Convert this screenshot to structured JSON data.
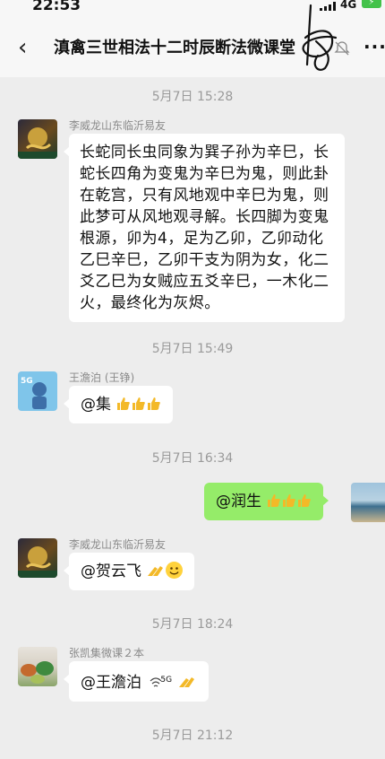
{
  "status": {
    "time": "22:53",
    "network": "4G"
  },
  "header": {
    "title": "滇禽三世相法十二时辰断法微课堂",
    "more": "···"
  },
  "timestamps": [
    "5月7日 15:28",
    "5月7日 15:49",
    "5月7日 16:34",
    "5月7日 18:24",
    "5月7日 21:12"
  ],
  "messages": [
    {
      "sender": "李威龙山东临沂易友",
      "text": "长蛇同长虫同象为巽子孙为辛巳，长蛇长四角为变鬼为辛巳为鬼，则此卦在乾宫，只有风地观中辛巳为鬼，则此梦可从风地观寻解。长四脚为变鬼根源，卯为4，足为乙卯，乙卯动化乙巳辛巳，乙卯干支为阴为女，化二爻乙巳为女贼应五爻辛巳，一木化二火，最终化为灰烬。"
    },
    {
      "sender": "王澹泊 (王铮)",
      "text": "@集"
    },
    {
      "sender": "me",
      "text": "@润生"
    },
    {
      "sender": "李威龙山东临沂易友",
      "text": "@贺云飞"
    },
    {
      "sender": "张凯集微课２本",
      "text": "@王澹泊",
      "suffix": "5G"
    }
  ],
  "colors": {
    "bubble_self": "#95ec69",
    "bubble_other": "#ffffff",
    "background": "#ededed"
  }
}
